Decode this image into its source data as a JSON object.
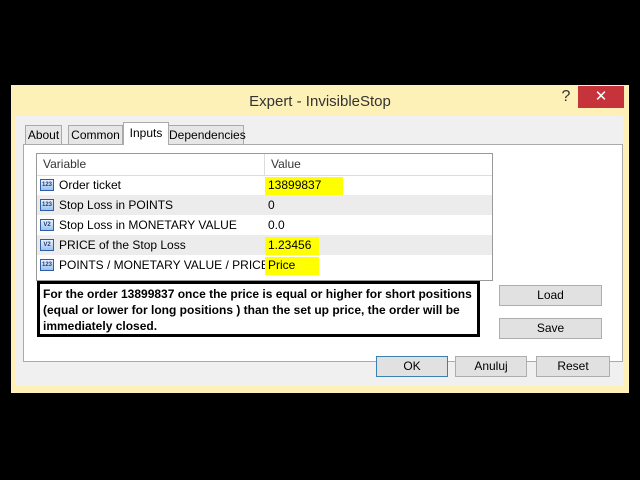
{
  "window": {
    "title": "Expert - InvisibleStop",
    "help_glyph": "?",
    "close_glyph": "✕"
  },
  "tabs": [
    {
      "label": "About",
      "active": false
    },
    {
      "label": "Common",
      "active": false
    },
    {
      "label": "Inputs",
      "active": true
    },
    {
      "label": "Dependencies",
      "active": false
    }
  ],
  "grid": {
    "headers": {
      "variable": "Variable",
      "value": "Value"
    },
    "rows": [
      {
        "icon": "int-param-icon",
        "icon_text": "123",
        "label": "Order ticket",
        "value": "13899837",
        "highlight": true
      },
      {
        "icon": "int-param-icon",
        "icon_text": "123",
        "label": "Stop Loss in POINTS",
        "value": "0",
        "highlight": false
      },
      {
        "icon": "double-param-icon",
        "icon_text": "V2",
        "label": "Stop Loss in MONETARY VALUE",
        "value": "0.0",
        "highlight": false
      },
      {
        "icon": "double-param-icon",
        "icon_text": "V2",
        "label": "PRICE of the Stop Loss",
        "value": "1.23456",
        "highlight": true
      },
      {
        "icon": "int-param-icon",
        "icon_text": "123",
        "label": "POINTS / MONETARY VALUE / PRICE",
        "value": "Price",
        "highlight": true
      }
    ]
  },
  "note": {
    "lines": [
      "For the order 13899837 once the price is equal or higher for short positions",
      "(equal or lower for long positions ) than the set up price, the order will be",
      "immediately closed."
    ]
  },
  "side_buttons": {
    "load": "Load",
    "save": "Save"
  },
  "footer_buttons": {
    "ok": "OK",
    "cancel": "Anuluj",
    "reset": "Reset"
  },
  "colors": {
    "highlight": "#ffff00",
    "title_bar": "#fdf1b8",
    "close": "#c7333a"
  }
}
